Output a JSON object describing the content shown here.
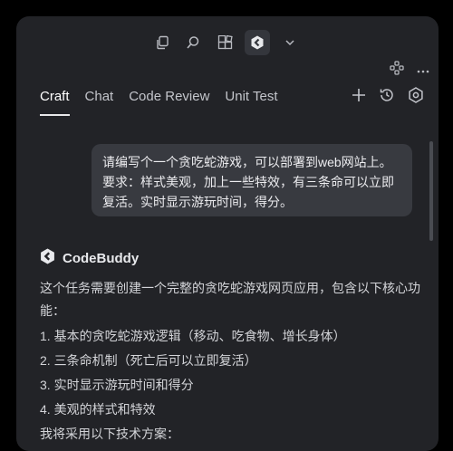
{
  "tabs": [
    {
      "label": "Craft",
      "active": true
    },
    {
      "label": "Chat",
      "active": false
    },
    {
      "label": "Code Review",
      "active": false
    },
    {
      "label": "Unit Test",
      "active": false
    }
  ],
  "user_message": "请编写个一个贪吃蛇游戏，可以部署到web网站上。要求：样式美观，加上一些特效，有三条命可以立即复活。实时显示游玩时间，得分。",
  "assistant": {
    "name": "CodeBuddy",
    "intro": "这个任务需要创建一个完整的贪吃蛇游戏网页应用，包含以下核心功能：",
    "items": [
      "1. 基本的贪吃蛇游戏逻辑（移动、吃食物、增长身体）",
      "2. 三条命机制（死亡后可以立即复活）",
      "3. 实时显示游玩时间和得分",
      "4. 美观的样式和特效"
    ],
    "outro": "我将采用以下技术方案："
  },
  "icons": {
    "toolbar": [
      "copy-icon",
      "search-icon",
      "extensions-icon",
      "codebuddy-icon",
      "chevron-down-icon"
    ],
    "secondary": [
      "plugin-icon",
      "more-icon"
    ],
    "tab_actions": [
      "plus-icon",
      "history-icon",
      "settings-icon"
    ]
  },
  "colors": {
    "panel_bg": "#222327",
    "bubble_bg": "#383a40",
    "text": "#d6d7db"
  }
}
